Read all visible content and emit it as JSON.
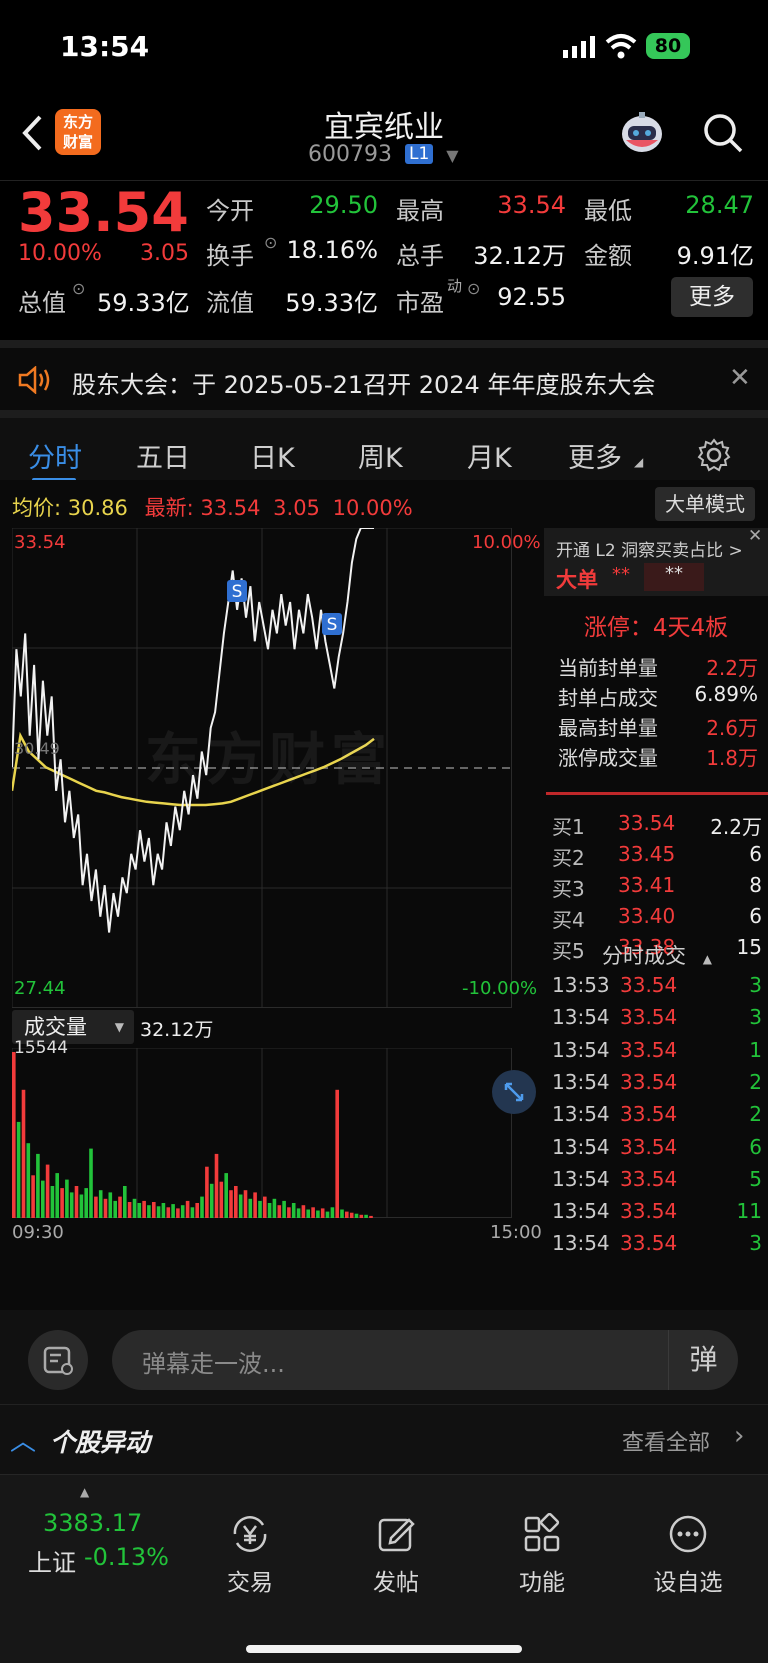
{
  "status_bar": {
    "time": "13:54",
    "battery": "80"
  },
  "header": {
    "title": "宜宾纸业",
    "code": "600793",
    "level_badge": "L1",
    "logo_line1": "东方",
    "logo_line2": "财富"
  },
  "quote": {
    "price": "33.54",
    "change_pct": "10.00%",
    "change": "3.05",
    "open_label": "今开",
    "open": "29.50",
    "high_label": "最高",
    "high": "33.54",
    "low_label": "最低",
    "low": "28.47",
    "turnover_label": "换手",
    "turnover": "18.16%",
    "volume_label": "总手",
    "volume": "32.12万",
    "amount_label": "金额",
    "amount": "9.91亿",
    "mcap_label": "总值",
    "mcap": "59.33亿",
    "float_label": "流值",
    "float": "59.33亿",
    "pe_label": "市盈",
    "pe_sup": "动",
    "pe": "92.55",
    "more_button": "更多"
  },
  "notice": {
    "text": "股东大会：于 2025-05-21召开 2024 年年度股东大会"
  },
  "tabs": [
    "分时",
    "五日",
    "日K",
    "周K",
    "月K",
    "更多"
  ],
  "chart_header": {
    "avg_label": "均价:",
    "avg": "30.86",
    "latest_label": "最新:",
    "latest": "33.54",
    "latest_change": "3.05",
    "latest_pct": "10.00%",
    "mode_button": "大单模式"
  },
  "chart_data": {
    "type": "line",
    "y_top": "33.54",
    "y_bottom": "27.44",
    "y_mid": "30.49",
    "pct_top": "10.00%",
    "pct_bottom": "-10.00%",
    "x_start": "09:30",
    "x_end": "15:00",
    "ylim": [
      27.44,
      33.54
    ],
    "grid": true,
    "watermark": "东方财富",
    "price_series": [
      30.5,
      32.0,
      31.4,
      32.2,
      30.9,
      31.8,
      30.6,
      31.6,
      30.9,
      31.4,
      30.2,
      30.6,
      29.8,
      30.2,
      29.6,
      29.9,
      29.0,
      29.4,
      28.8,
      29.2,
      28.6,
      29.0,
      28.4,
      28.9,
      28.6,
      29.1,
      28.9,
      29.4,
      29.2,
      29.7,
      29.3,
      29.6,
      29.0,
      29.4,
      29.2,
      29.8,
      29.5,
      30.0,
      29.7,
      30.2,
      29.9,
      30.4,
      30.1,
      30.7,
      30.4,
      31.0,
      31.2,
      31.7,
      32.2,
      32.6,
      33.0,
      32.5,
      32.9,
      32.4,
      32.8,
      32.1,
      32.6,
      32.3,
      32.0,
      32.5,
      32.2,
      32.7,
      32.3,
      32.6,
      32.0,
      32.5,
      32.2,
      32.7,
      32.4,
      32.0,
      32.5,
      32.1,
      31.8,
      31.5,
      31.9,
      32.2,
      32.6,
      33.1,
      33.4,
      33.54,
      33.54,
      33.54,
      33.54
    ],
    "avg_series": [
      30.2,
      30.9,
      30.7,
      30.6,
      30.5,
      30.45,
      30.4,
      30.35,
      30.3,
      30.25,
      30.2,
      30.18,
      30.15,
      30.12,
      30.1,
      30.08,
      30.06,
      30.05,
      30.04,
      30.03,
      30.02,
      30.02,
      30.02,
      30.02,
      30.03,
      30.04,
      30.06,
      30.1,
      30.14,
      30.18,
      30.22,
      30.26,
      30.3,
      30.34,
      30.38,
      30.42,
      30.46,
      30.5,
      30.55,
      30.6,
      30.66,
      30.72,
      30.78,
      30.86
    ],
    "volume_label": "成交量",
    "volume_total": "32.12万",
    "volume_max": "15544",
    "volume_series": [
      15544,
      9000,
      12000,
      7000,
      4000,
      6000,
      3500,
      5000,
      3000,
      4200,
      2800,
      3600,
      2400,
      3000,
      2200,
      2800,
      6500,
      2000,
      2600,
      1800,
      2400,
      1600,
      2000,
      3000,
      1500,
      1800,
      1400,
      1600,
      1200,
      1500,
      1100,
      1400,
      1000,
      1300,
      900,
      1200,
      1600,
      1000,
      1400,
      2000,
      4800,
      3200,
      6000,
      3400,
      4200,
      2600,
      3000,
      2200,
      2600,
      1800,
      2400,
      1600,
      2000,
      1400,
      1800,
      1200,
      1600,
      1000,
      1400,
      900,
      1200,
      800,
      1000,
      700,
      900,
      600,
      1000,
      12000,
      800,
      600,
      500,
      400,
      300,
      300,
      200
    ],
    "volume_colors": [
      "r",
      "g",
      "r",
      "g",
      "r",
      "g",
      "g",
      "r",
      "g",
      "g",
      "r",
      "g",
      "g",
      "r",
      "g",
      "g",
      "g",
      "r",
      "g",
      "r",
      "g",
      "g",
      "r",
      "g",
      "r",
      "g",
      "g",
      "r",
      "g",
      "r",
      "g",
      "g",
      "r",
      "g",
      "r",
      "g",
      "r",
      "g",
      "r",
      "g",
      "r",
      "g",
      "r",
      "r",
      "g",
      "r",
      "r",
      "g",
      "r",
      "g",
      "r",
      "g",
      "r",
      "g",
      "g",
      "r",
      "g",
      "r",
      "g",
      "g",
      "r",
      "g",
      "r",
      "g",
      "r",
      "g",
      "g",
      "r",
      "g",
      "r",
      "r",
      "g",
      "r",
      "g",
      "r"
    ]
  },
  "right_panel": {
    "promo": "开通 L2 洞察买卖占比 >",
    "big_label": "大单",
    "big_val1": "**",
    "big_val2": "**",
    "limit_title": "涨停：4天4板",
    "stats": [
      {
        "label": "当前封单量",
        "value": "2.2万"
      },
      {
        "label": "封单占成交",
        "value": "6.89%"
      },
      {
        "label": "最高封单量",
        "value": "2.6万"
      },
      {
        "label": "涨停成交量",
        "value": "1.8万"
      }
    ],
    "bids": [
      {
        "label": "买1",
        "price": "33.54",
        "qty": "2.2万"
      },
      {
        "label": "买2",
        "price": "33.45",
        "qty": "6"
      },
      {
        "label": "买3",
        "price": "33.41",
        "qty": "8"
      },
      {
        "label": "买4",
        "price": "33.40",
        "qty": "6"
      },
      {
        "label": "买5",
        "price": "33.38",
        "qty": "15"
      }
    ],
    "trades_title": "分时成交",
    "trades": [
      {
        "time": "13:53",
        "price": "33.54",
        "qty": "3"
      },
      {
        "time": "13:54",
        "price": "33.54",
        "qty": "3"
      },
      {
        "time": "13:54",
        "price": "33.54",
        "qty": "1"
      },
      {
        "time": "13:54",
        "price": "33.54",
        "qty": "2"
      },
      {
        "time": "13:54",
        "price": "33.54",
        "qty": "2"
      },
      {
        "time": "13:54",
        "price": "33.54",
        "qty": "6"
      },
      {
        "time": "13:54",
        "price": "33.54",
        "qty": "5"
      },
      {
        "time": "13:54",
        "price": "33.54",
        "qty": "11"
      },
      {
        "time": "13:54",
        "price": "33.54",
        "qty": "3"
      }
    ]
  },
  "barrage": {
    "placeholder": "弹幕走一波...",
    "send_label": "弹"
  },
  "movers": {
    "title": "个股异动",
    "view_all": "查看全部"
  },
  "bottom_nav": {
    "index_value": "3383.17",
    "index_name": "上证",
    "index_pct": "-0.13%",
    "items": [
      "交易",
      "发帖",
      "功能",
      "设自选"
    ]
  },
  "colors": {
    "up": "#f23b3b",
    "down": "#22c33a",
    "accent": "#3a8ee6",
    "avg_line": "#e8d44d"
  }
}
